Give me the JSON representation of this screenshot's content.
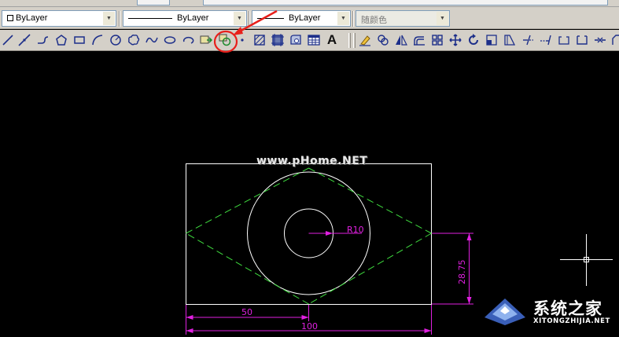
{
  "properties_toolbar": {
    "color_control": "ByLayer",
    "linetype_control": "ByLayer",
    "lineweight_control": "ByLayer",
    "plotstyle_control": "随颜色"
  },
  "draw_toolbar": {
    "tools": [
      "line-tool",
      "construction-line-tool",
      "polyline-tool",
      "polygon-tool",
      "rectangle-tool",
      "arc-tool",
      "circle-tool",
      "revision-cloud-tool",
      "spline-tool",
      "ellipse-tool",
      "ellipse-arc-tool",
      "insert-block-tool",
      "make-block-tool",
      "point-tool",
      "hatch-tool",
      "gradient-tool",
      "region-tool",
      "table-tool",
      "multiline-text-tool"
    ],
    "text_tool_glyph": "A"
  },
  "modify_toolbar": {
    "tools": [
      "erase-tool",
      "copy-tool",
      "mirror-tool",
      "offset-tool",
      "array-tool",
      "move-tool",
      "rotate-tool",
      "scale-tool",
      "stretch-tool",
      "trim-tool",
      "extend-tool",
      "break-at-point-tool",
      "break-tool",
      "join-tool",
      "chamfer-tool",
      "fillet-tool"
    ]
  },
  "annotation": {
    "highlight_color": "#e8201b",
    "highlighted_tool": "make-block-tool"
  },
  "drawing": {
    "background_color": "#000000",
    "geometry_color": "#ffffff",
    "construction_color": "#3fdc3f",
    "dimension_color": "#e020e0",
    "radius_label": "R10",
    "dim_half_width": "50",
    "dim_full_width": "100",
    "dim_height": "28.75"
  },
  "watermarks": {
    "web_text": "www.pHome.NET",
    "brand_cn": "系统之家",
    "brand_en": "XITONGZHIJIA.NET"
  }
}
